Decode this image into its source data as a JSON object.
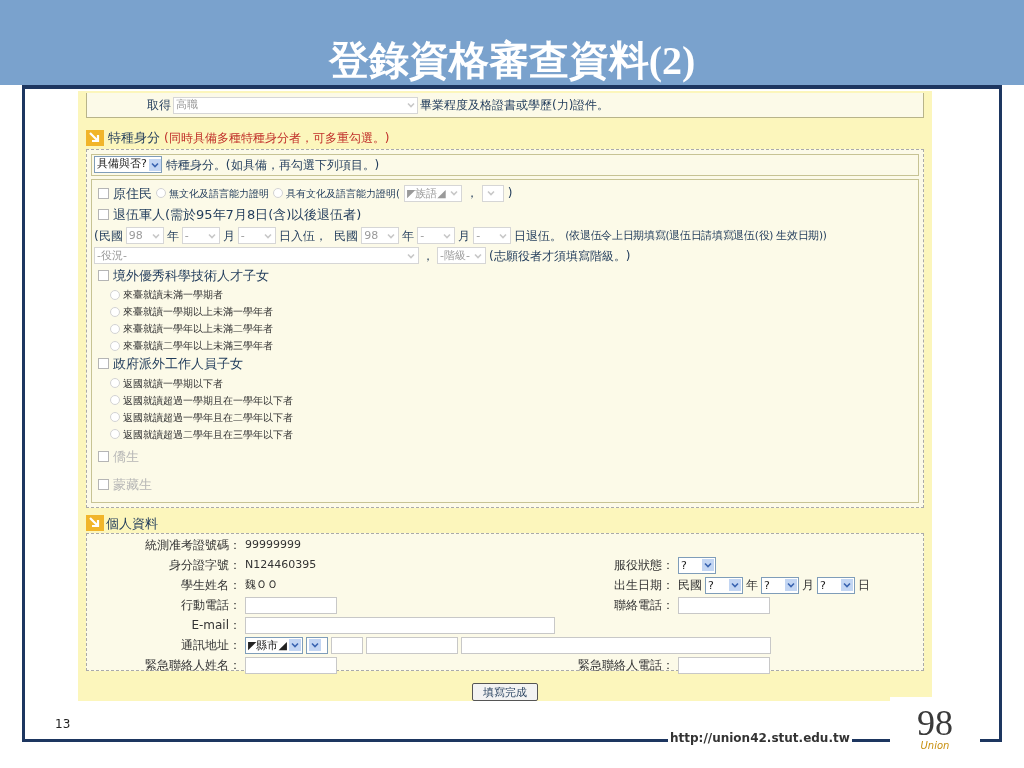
{
  "slide": {
    "title": "登錄資格審查資料(2)",
    "number": "13",
    "url": "http://union42.stut.edu.tw",
    "logo": {
      "numeral": "98",
      "word": "Union"
    }
  },
  "top_row": {
    "prefix": "取得",
    "select_value": "高職",
    "suffix": "畢業程度及格證書或學歷(力)證件。"
  },
  "special": {
    "title": "特種身分",
    "note": "(同時具備多種特種身分者，可多重勾選。)",
    "has_select": "具備與否?",
    "has_text": "特種身分。(如具備，再勾選下列項目。)",
    "items": [
      {
        "kind": "inline",
        "label": "原住民",
        "checked": false,
        "disabled": false,
        "parts": [
          {
            "kind": "radio",
            "label": "無文化及語言能力證明",
            "selected": false
          },
          {
            "kind": "radio",
            "label": "具有文化及語言能力證明(",
            "selected": false
          },
          {
            "kind": "select",
            "value": "◤族語◢",
            "disabled": true
          },
          {
            "kind": "text",
            "text": "，"
          },
          {
            "kind": "select",
            "disabled": true
          },
          {
            "kind": "text",
            "text": ")"
          }
        ]
      },
      {
        "kind": "lines",
        "label": "退伍軍人(需於95年7月8日(含)以後退伍者)",
        "checked": false,
        "disabled": false,
        "lines": [
          [
            {
              "kind": "text",
              "text": "(民國"
            },
            {
              "kind": "select",
              "value": "98",
              "disabled": true
            },
            {
              "kind": "text",
              "text": "年"
            },
            {
              "kind": "select",
              "value": "-",
              "disabled": true
            },
            {
              "kind": "text",
              "text": "月"
            },
            {
              "kind": "select",
              "value": "-",
              "disabled": true
            },
            {
              "kind": "text",
              "text": "日入伍，  民國"
            },
            {
              "kind": "select",
              "value": "98",
              "disabled": true
            },
            {
              "kind": "text",
              "text": "年"
            },
            {
              "kind": "select",
              "value": "-",
              "disabled": true
            },
            {
              "kind": "text",
              "text": "月"
            },
            {
              "kind": "select",
              "value": "-",
              "disabled": true
            },
            {
              "kind": "text",
              "text": "日退伍。"
            },
            {
              "kind": "note",
              "text": "(依退伍令上日期填寫(退伍日請填寫退伍(役) 生效日期))"
            }
          ],
          [
            {
              "kind": "wide_select",
              "value": "-役況-",
              "disabled": true
            },
            {
              "kind": "text",
              "text": "，"
            },
            {
              "kind": "select",
              "value": "-階級-",
              "disabled": true
            },
            {
              "kind": "text",
              "text": "(志願役者才須填寫階級。)"
            }
          ]
        ]
      },
      {
        "kind": "options",
        "label": "境外優秀科學技術人才子女",
        "checked": false,
        "disabled": false,
        "options": [
          {
            "label": "來臺就讀未滿一學期者",
            "selected": false
          },
          {
            "label": "來臺就讀一學期以上未滿一學年者",
            "selected": false
          },
          {
            "label": "來臺就讀一學年以上未滿二學年者",
            "selected": false
          },
          {
            "label": "來臺就讀二學年以上未滿三學年者",
            "selected": false
          }
        ]
      },
      {
        "kind": "options",
        "label": "政府派外工作人員子女",
        "checked": false,
        "disabled": false,
        "options": [
          {
            "label": "返國就讀一學期以下者",
            "selected": false
          },
          {
            "label": "返國就讀超過一學期且在一學年以下者",
            "selected": false
          },
          {
            "label": "返國就讀超過一學年且在二學年以下者",
            "selected": false
          },
          {
            "label": "返國就讀超過二學年且在三學年以下者",
            "selected": false
          }
        ]
      },
      {
        "kind": "plain",
        "label": "僑生",
        "checked": false,
        "disabled": true
      },
      {
        "kind": "plain",
        "label": "蒙藏生",
        "checked": false,
        "disabled": true
      }
    ]
  },
  "personal": {
    "title": "個人資料",
    "rows": [
      {
        "left": {
          "label": "統測准考證號碼：",
          "parts": [
            {
              "kind": "value",
              "text": "99999999"
            }
          ]
        }
      },
      {
        "left": {
          "label": "身分證字號：",
          "parts": [
            {
              "kind": "value",
              "text": "N124460395"
            }
          ]
        },
        "right": {
          "label": "服役狀態：",
          "parts": [
            {
              "kind": "select",
              "value": "?",
              "disabled": false
            }
          ]
        }
      },
      {
        "left": {
          "label": "學生姓名：",
          "parts": [
            {
              "kind": "value",
              "text": "魏ＯＯ"
            }
          ]
        },
        "right": {
          "label": "出生日期：",
          "parts": [
            {
              "kind": "text",
              "text": "民國"
            },
            {
              "kind": "select",
              "value": "?",
              "disabled": false
            },
            {
              "kind": "text",
              "text": "年"
            },
            {
              "kind": "select",
              "value": "?",
              "disabled": false
            },
            {
              "kind": "text",
              "text": "月"
            },
            {
              "kind": "select",
              "value": "?",
              "disabled": false
            },
            {
              "kind": "text",
              "text": "日"
            }
          ]
        }
      },
      {
        "left": {
          "label": "行動電話：",
          "parts": [
            {
              "kind": "input"
            }
          ]
        },
        "right": {
          "label": "聯絡電話：",
          "parts": [
            {
              "kind": "input"
            }
          ]
        }
      },
      {
        "left": {
          "label": "E-mail：",
          "parts": [
            {
              "kind": "wide_input"
            }
          ]
        }
      },
      {
        "left": {
          "label": "通訊地址：",
          "parts": [
            {
              "kind": "select",
              "value": "◤縣市◢",
              "disabled": false
            },
            {
              "kind": "select",
              "disabled": false
            },
            {
              "kind": "short_input"
            },
            {
              "kind": "input"
            },
            {
              "kind": "wide_input"
            }
          ]
        }
      },
      {
        "left": {
          "label": "緊急聯絡人姓名：",
          "parts": [
            {
              "kind": "input"
            }
          ]
        },
        "right": {
          "label": "緊急聯絡人電話：",
          "parts": [
            {
              "kind": "input"
            }
          ]
        }
      }
    ]
  },
  "submit": "填寫完成"
}
